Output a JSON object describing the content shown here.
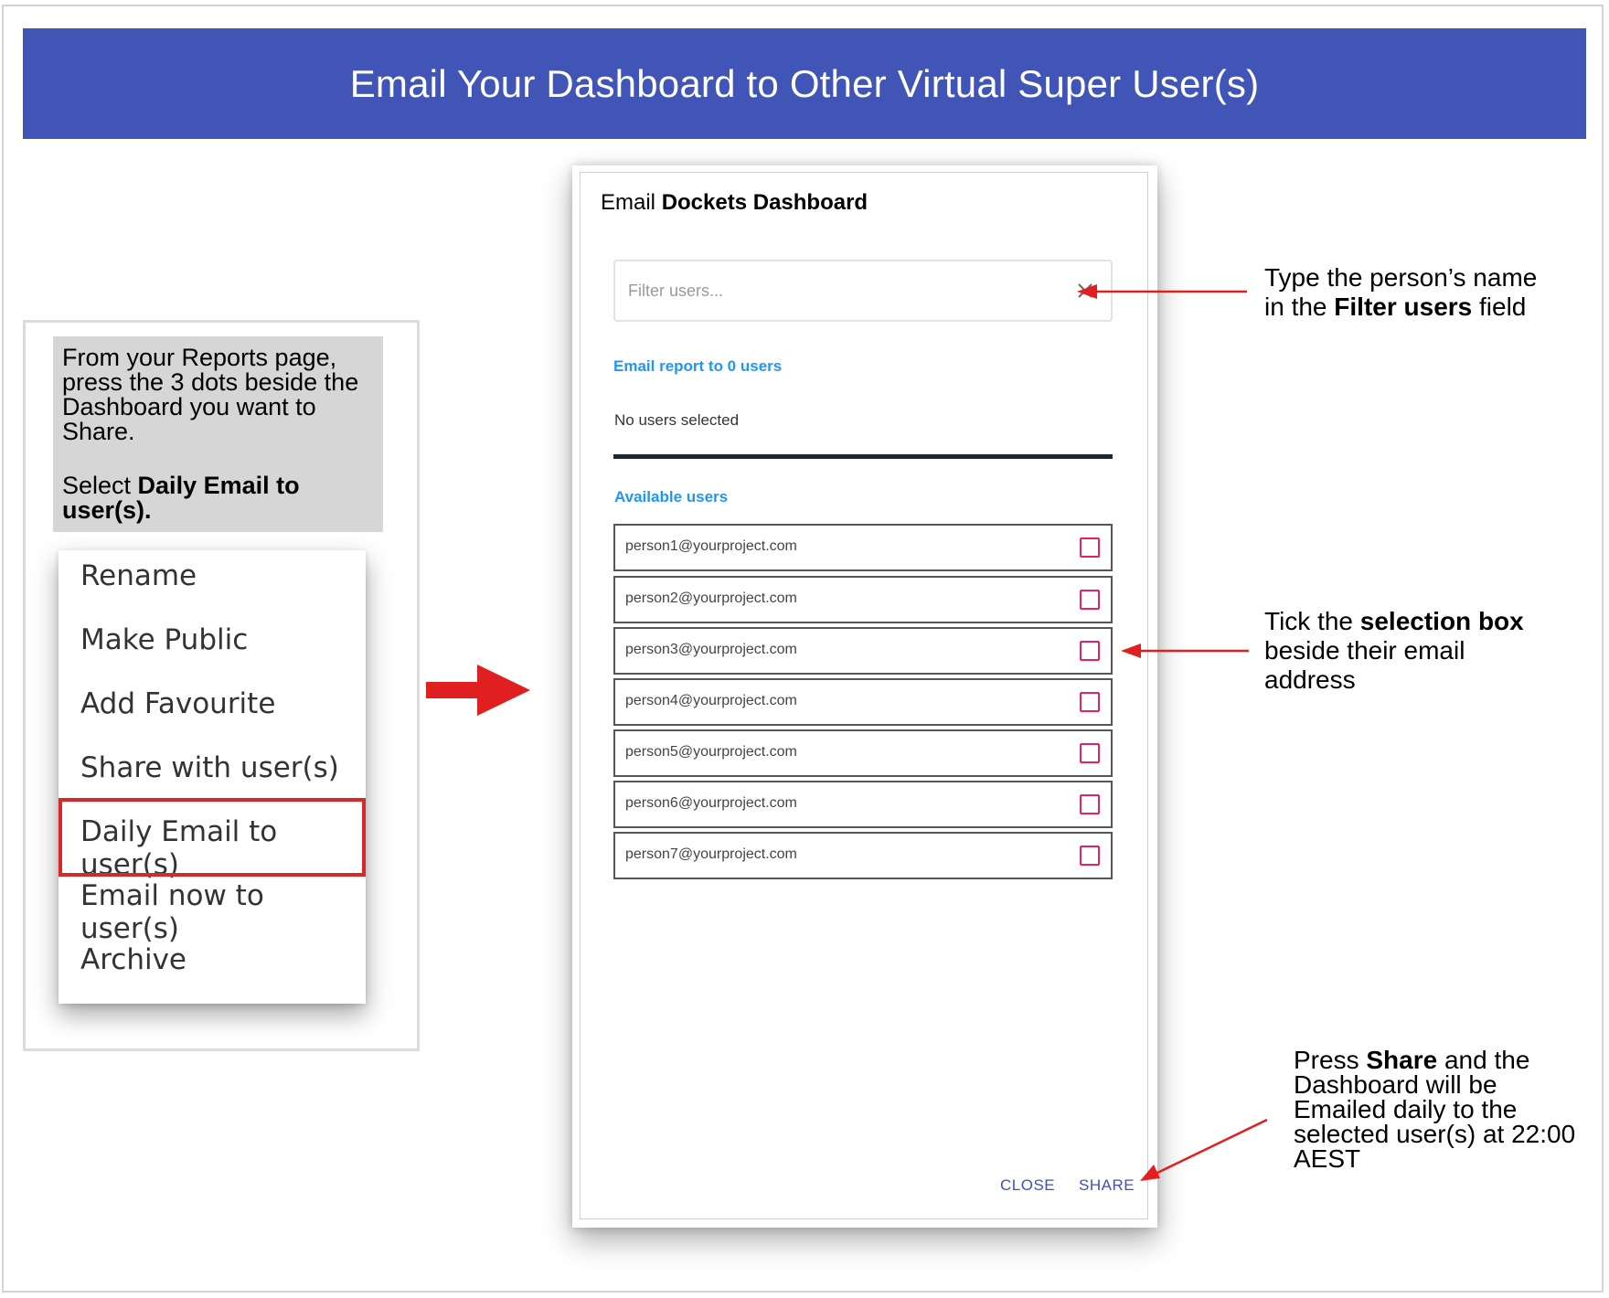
{
  "banner": {
    "title": "Email Your Dashboard to Other Virtual Super User(s)"
  },
  "instructions": {
    "line1": "From your Reports page, press the 3 dots beside the Dashboard you want to Share.",
    "line2_prefix": "Select ",
    "line2_bold": "Daily Email to user(s)."
  },
  "menu": {
    "items": [
      {
        "label": "Rename"
      },
      {
        "label": "Make Public"
      },
      {
        "label": "Add Favourite"
      },
      {
        "label": "Share with user(s)"
      },
      {
        "label": "Daily Email to user(s)"
      },
      {
        "label": "Email now to user(s)"
      },
      {
        "label": "Archive"
      }
    ],
    "highlight_color": "#d62a2a"
  },
  "dialog": {
    "title_prefix": "Email ",
    "title_bold": "Dockets Dashboard",
    "filter": {
      "placeholder": "Filter users...",
      "value": ""
    },
    "email_count_label": "Email report to 0 users",
    "no_users_label": "No users selected",
    "available_label": "Available users",
    "users": [
      {
        "email": "person1@yourproject.com",
        "selected": false
      },
      {
        "email": "person2@yourproject.com",
        "selected": false
      },
      {
        "email": "person3@yourproject.com",
        "selected": false
      },
      {
        "email": "person4@yourproject.com",
        "selected": false
      },
      {
        "email": "person5@yourproject.com",
        "selected": false
      },
      {
        "email": "person6@yourproject.com",
        "selected": false
      },
      {
        "email": "person7@yourproject.com",
        "selected": false
      }
    ],
    "close_label": "CLOSE",
    "share_label": "SHARE"
  },
  "callouts": {
    "filter": {
      "line1": "Type the person’s name",
      "line2_prefix": "in the ",
      "line2_bold": "Filter users",
      "line2_suffix": " field"
    },
    "select": {
      "line1_prefix": "Tick the ",
      "line1_bold": "selection box",
      "line2": "beside their email",
      "line3": "address"
    },
    "share": {
      "line1_prefix": "Press ",
      "line1_bold": "Share",
      "line1_suffix": " and the",
      "line2": "Dashboard will be",
      "line3": "Emailed daily to the",
      "line4": "selected user(s) at 22:00",
      "line5": "AEST"
    }
  },
  "colors": {
    "banner": "#4155b6",
    "accent_blue": "#2196f3",
    "button_blue": "#3f51b5",
    "checkbox": "#e91e63",
    "arrow_red": "#e02020"
  }
}
